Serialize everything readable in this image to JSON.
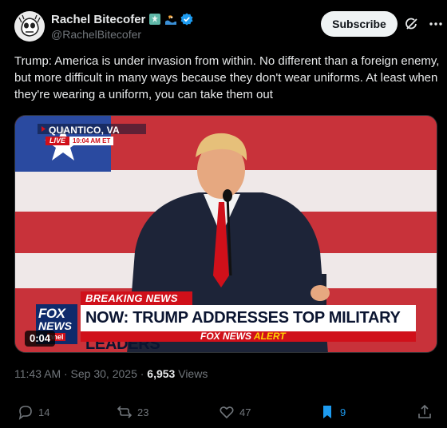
{
  "author": {
    "display_name": "Rachel Bitecofer",
    "handle": "@RachelBitecofer",
    "badges": [
      "statue-of-liberty-emoji",
      "water-wave-emoji",
      "verified-badge-icon"
    ]
  },
  "header": {
    "subscribe_label": "Subscribe",
    "icons": [
      "grok-icon",
      "more-options-icon"
    ]
  },
  "tweet": {
    "text": "Trump: America is under invasion from within. No different than a foreign enemy, but more difficult in many ways because they don't wear uniforms. At least when they're wearing a uniform, you can take them out"
  },
  "video": {
    "location": "QUANTICO, VA",
    "live_label": "LIVE",
    "live_time": "10:04 AM ET",
    "breaking_label": "BREAKING NEWS",
    "headline": "NOW: TRUMP ADDRESSES TOP MILITARY LEADERS",
    "alert_prefix": "FOX NEWS",
    "alert_suffix": "ALERT",
    "logo_line1": "FOX",
    "logo_line2": "NEWS",
    "logo_line3": "nnel",
    "duration": "0:04"
  },
  "meta": {
    "timestamp": "11:43 AM · Sep 30, 2025 · ",
    "views_count": "6,953",
    "views_label": " Views"
  },
  "actions": {
    "replies": "14",
    "reposts": "23",
    "likes": "47",
    "bookmarks": "9"
  },
  "colors": {
    "background": "#000000",
    "text": "#e7e9ea",
    "muted": "#71767b",
    "accent": "#1d9bf0",
    "fox_red": "#d0101a",
    "fox_blue": "#0f2a6b"
  }
}
